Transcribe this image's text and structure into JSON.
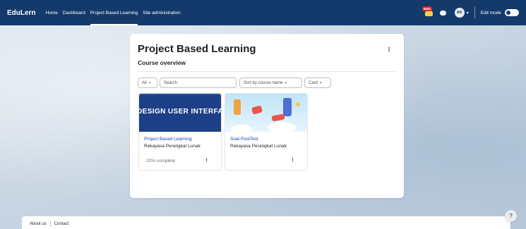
{
  "navbar": {
    "brand": "EduLern",
    "links": [
      "Home",
      "Dashboard",
      "Project Based Learning",
      "Site administration"
    ],
    "active_link": "Project Based Learning",
    "notification_count": "9843",
    "avatar_initials": "AK",
    "edit_mode_label": "Edit mode",
    "edit_mode_on": false
  },
  "main": {
    "title": "Project Based Learning",
    "section_title": "Course overview",
    "filters": {
      "grouping_value": "All",
      "search_placeholder": "Search",
      "sort_value": "Sort by course name",
      "view_value": "Card"
    },
    "courses": [
      {
        "banner_text": "DESIGN USER INTERFACE",
        "name": "Project Based Learning",
        "category": "Rekayasa Perangkat Lunak",
        "progress_text": "20% complete",
        "progress_percent": 20
      },
      {
        "name": "Soal PostTest",
        "category": "Rekayasa Perangkat Lunak"
      }
    ]
  },
  "footer": {
    "links": [
      "About us",
      "Contact"
    ]
  },
  "help_label": "?",
  "icons": {
    "notification": "bell-icon",
    "messages": "chat-icon",
    "menu": "kebab-icon",
    "dropdown": "chevron-down-icon"
  },
  "colors": {
    "navbar_bg": "#143a6b",
    "link_color": "#0f47ad",
    "notification_badge": "#e2202a"
  }
}
